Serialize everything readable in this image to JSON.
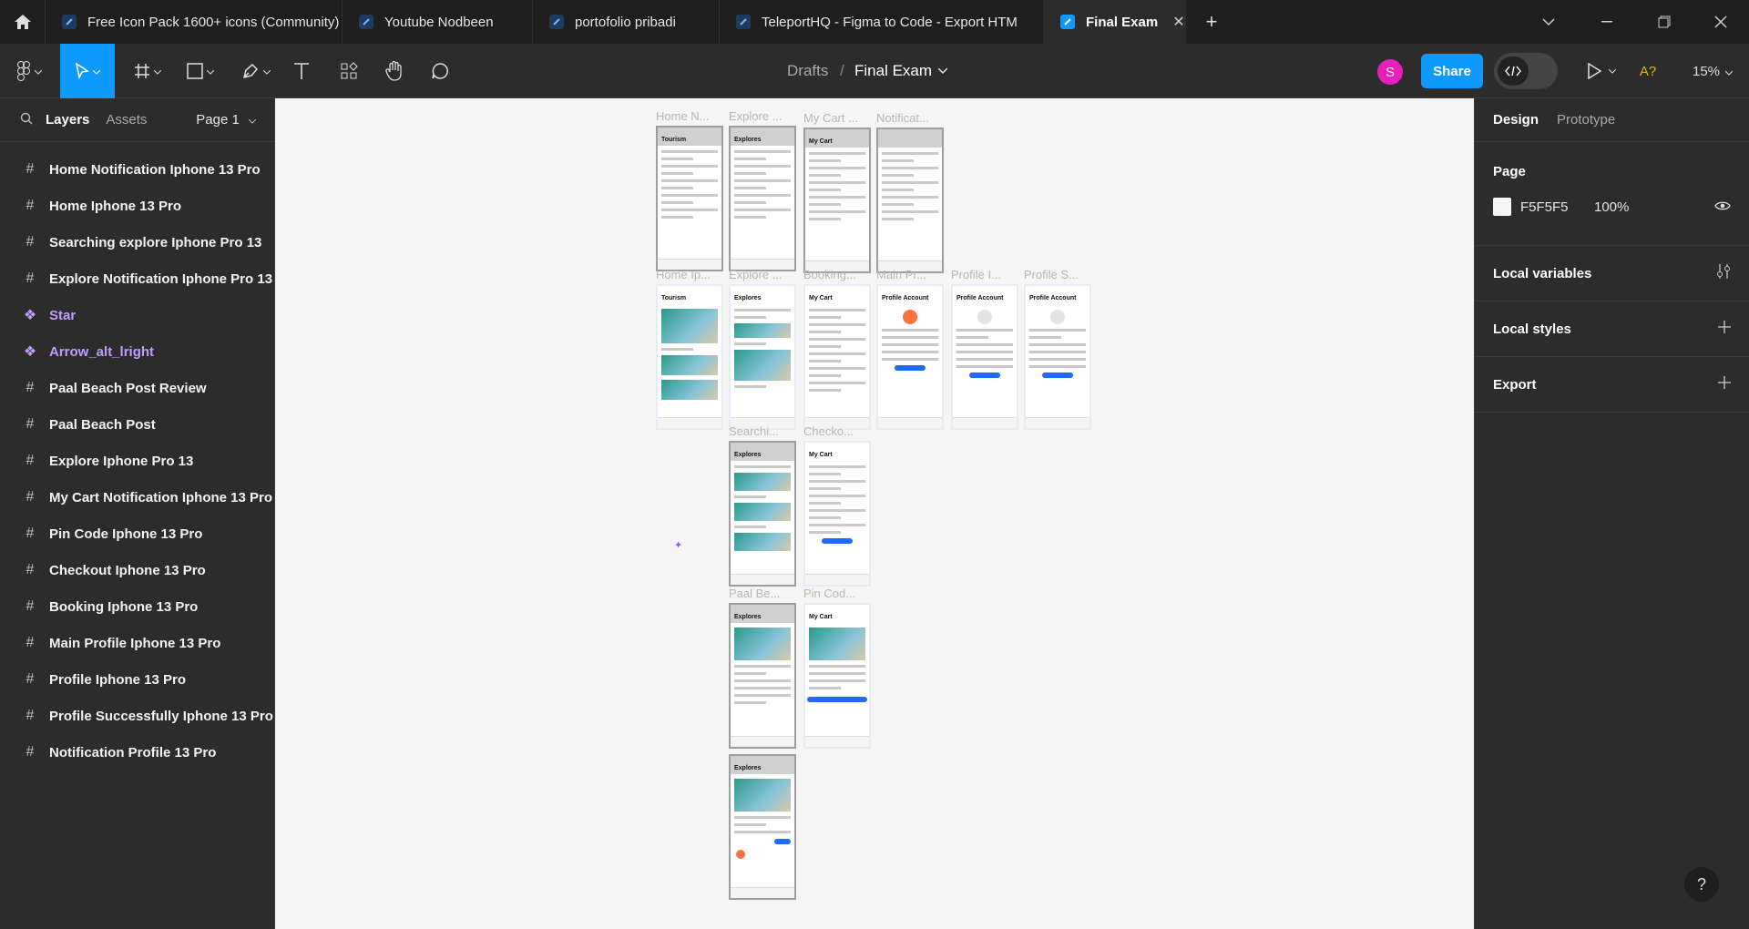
{
  "tabs": [
    {
      "title": "Free Icon Pack 1600+ icons (Community)",
      "active": false
    },
    {
      "title": "Youtube Nodbeen",
      "active": false
    },
    {
      "title": "portofolio pribadi",
      "active": false
    },
    {
      "title": "TeleportHQ - Figma to Code - Export HTM",
      "active": false
    },
    {
      "title": "Final Exam",
      "active": true
    }
  ],
  "toolbar": {
    "breadcrumb_parent": "Drafts",
    "breadcrumb_sep": "/",
    "file_name": "Final Exam",
    "avatar_initial": "S",
    "share_label": "Share",
    "zoom": "15%"
  },
  "left_panel": {
    "tab_layers": "Layers",
    "tab_assets": "Assets",
    "page_selector": "Page 1",
    "layers": [
      {
        "name": "Home Notification Iphone 13 Pro",
        "type": "frame"
      },
      {
        "name": "Home Iphone 13 Pro",
        "type": "frame"
      },
      {
        "name": "Searching explore Iphone Pro 13",
        "type": "frame"
      },
      {
        "name": "Explore Notification Iphone Pro 13",
        "type": "frame"
      },
      {
        "name": "Star",
        "type": "component"
      },
      {
        "name": "Arrow_alt_lright",
        "type": "component"
      },
      {
        "name": "Paal Beach Post Review",
        "type": "frame"
      },
      {
        "name": "Paal Beach Post",
        "type": "frame"
      },
      {
        "name": "Explore Iphone Pro 13",
        "type": "frame"
      },
      {
        "name": "My Cart Notification Iphone 13 Pro",
        "type": "frame"
      },
      {
        "name": "Pin Code Iphone 13 Pro",
        "type": "frame"
      },
      {
        "name": "Checkout Iphone 13 Pro",
        "type": "frame"
      },
      {
        "name": "Booking Iphone 13 Pro",
        "type": "frame"
      },
      {
        "name": "Main Profile Iphone 13 Pro",
        "type": "frame"
      },
      {
        "name": "Profile Iphone 13 Pro",
        "type": "frame"
      },
      {
        "name": "Profile Successfully Iphone 13 Pro",
        "type": "frame"
      },
      {
        "name": "Notification Profile 13 Pro",
        "type": "frame"
      }
    ]
  },
  "canvas": {
    "frames": [
      {
        "label": "Home N...",
        "header": "Tourism"
      },
      {
        "label": "Explore ...",
        "header": "Explores"
      },
      {
        "label": "My Cart ...",
        "header": "My Cart"
      },
      {
        "label": "Notificat...",
        "header": ""
      },
      {
        "label": "Home Ip...",
        "header": "Tourism"
      },
      {
        "label": "Explore ...",
        "header": "Explores"
      },
      {
        "label": "Booking...",
        "header": "My Cart"
      },
      {
        "label": "Main Pr...",
        "header": "Profile Account"
      },
      {
        "label": "Profile I...",
        "header": "Profile Account"
      },
      {
        "label": "Profile S...",
        "header": "Profile Account"
      },
      {
        "label": "Searchi...",
        "header": "Explores"
      },
      {
        "label": "Checko...",
        "header": "My Cart"
      },
      {
        "label": "Paal Be...",
        "header": "Explores"
      },
      {
        "label": "Pin Cod...",
        "header": "My Cart"
      },
      {
        "label": "",
        "header": "Explores"
      }
    ]
  },
  "right_panel": {
    "tab_design": "Design",
    "tab_prototype": "Prototype",
    "page_title": "Page",
    "page_color": "F5F5F5",
    "page_opacity": "100%",
    "local_variables": "Local variables",
    "local_styles": "Local styles",
    "export": "Export"
  },
  "help_label": "?"
}
